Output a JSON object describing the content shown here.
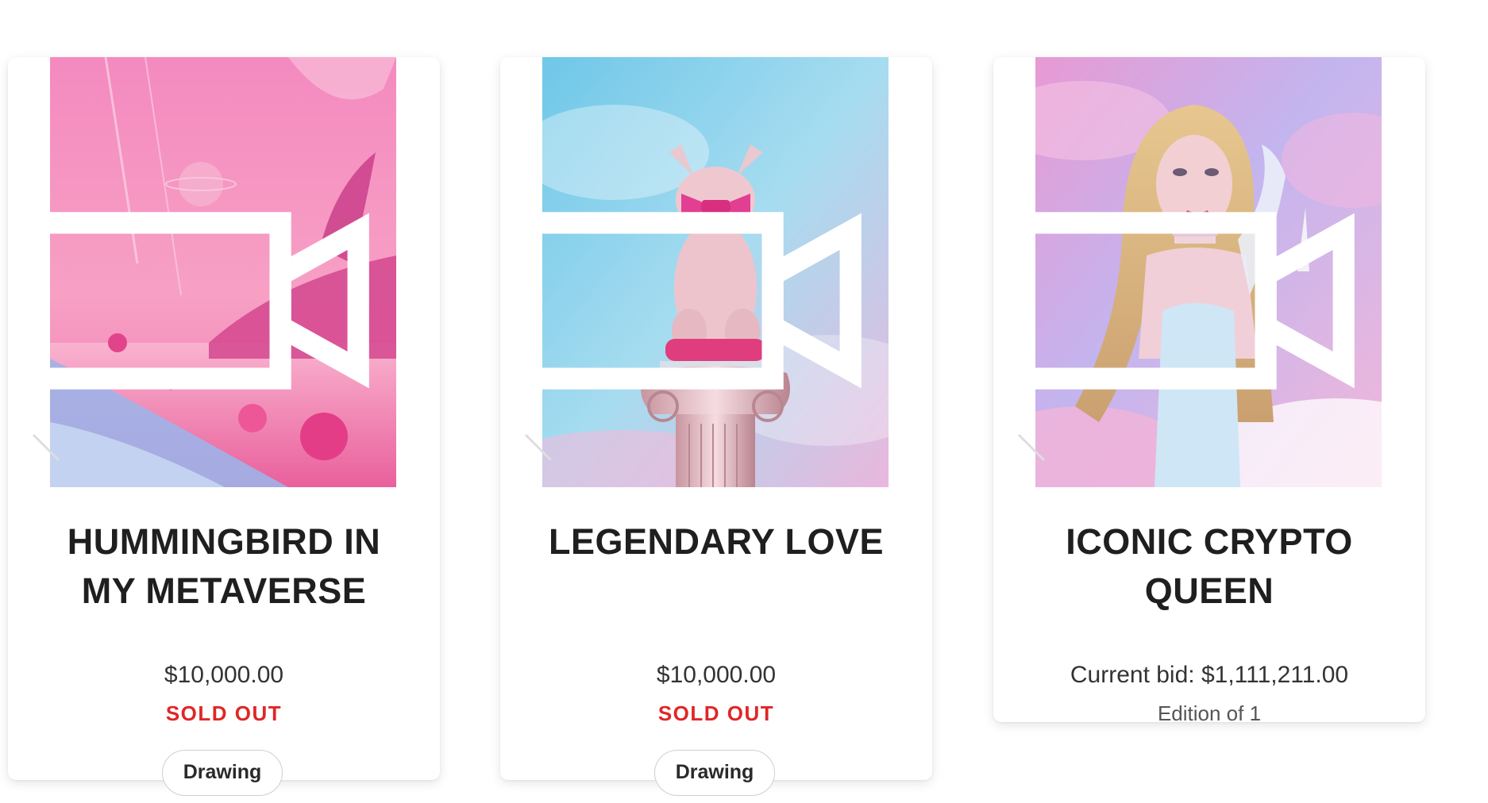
{
  "cards": [
    {
      "title": "HUMMINGBIRD IN MY METAVERSE",
      "price": "$10,000.00",
      "status": "SOLD OUT",
      "tag": "Drawing",
      "media_icon": "video-camera-icon",
      "sound_icon": "muted-speaker-icon"
    },
    {
      "title": "LEGENDARY LOVE",
      "price": "$10,000.00",
      "status": "SOLD OUT",
      "tag": "Drawing",
      "media_icon": "video-camera-icon",
      "sound_icon": "muted-speaker-icon"
    },
    {
      "title": "ICONIC CRYPTO QUEEN",
      "price": "Current bid: $1,111,211.00",
      "edition": "Edition of 1",
      "media_icon": "video-camera-icon",
      "sound_icon": "muted-speaker-icon"
    }
  ],
  "colors": {
    "status_red": "#e02626",
    "title_text": "#1f1f1f"
  }
}
